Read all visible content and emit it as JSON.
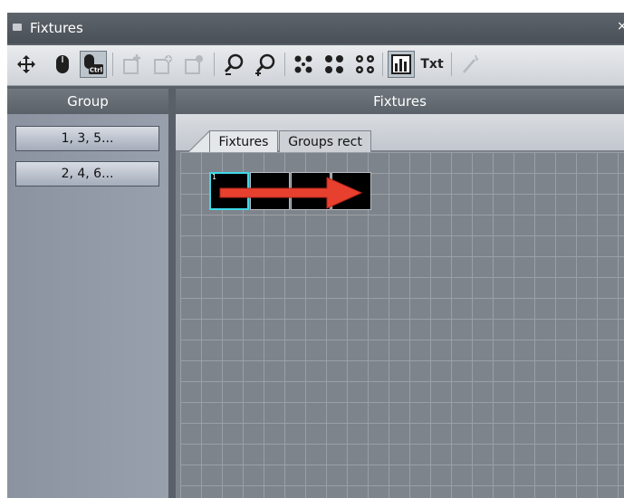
{
  "window": {
    "title": "Fixtures",
    "close_glyph": "×"
  },
  "toolbar": {
    "buttons": [
      {
        "name": "move-icon",
        "active": false,
        "enabled": true
      },
      {
        "name": "mouse-icon",
        "active": false,
        "enabled": true
      },
      {
        "name": "mouse-ctrl-icon",
        "active": true,
        "enabled": true,
        "label": "Ctrl"
      },
      {
        "name": "add-fixture-icon",
        "active": false,
        "enabled": false
      },
      {
        "name": "add-fixtures-icon",
        "active": false,
        "enabled": false
      },
      {
        "name": "fixture-settings-icon",
        "active": false,
        "enabled": false
      },
      {
        "name": "zoom-out-icon",
        "active": false,
        "enabled": true
      },
      {
        "name": "zoom-in-icon",
        "active": false,
        "enabled": true
      },
      {
        "name": "dots-large-icon",
        "active": false,
        "enabled": true
      },
      {
        "name": "dots-medium-icon",
        "active": false,
        "enabled": true
      },
      {
        "name": "dots-small-icon",
        "active": false,
        "enabled": true
      },
      {
        "name": "levels-icon",
        "active": true,
        "enabled": true
      },
      {
        "name": "text-toggle-icon",
        "active": false,
        "enabled": true,
        "label": "Txt"
      },
      {
        "name": "magic-wand-icon",
        "active": false,
        "enabled": false
      }
    ]
  },
  "left_panel": {
    "header": "Group",
    "groups": [
      "1, 3, 5...",
      "2, 4, 6..."
    ]
  },
  "right_panel": {
    "header": "Fixtures",
    "tabs": [
      {
        "label": "Fixtures",
        "selected": true
      },
      {
        "label": "Groups rect",
        "selected": false
      }
    ],
    "fixtures": [
      {
        "number": "1",
        "selected": true
      },
      {
        "number": "",
        "selected": false
      },
      {
        "number": "",
        "selected": false
      },
      {
        "number": "",
        "selected": false
      }
    ],
    "annotation": {
      "type": "arrow",
      "direction": "right",
      "color": "#e8402f"
    }
  },
  "colors": {
    "panel_bg": "#7e848b",
    "grid_line": "#9aa0a6",
    "selection": "#3fd9e8",
    "arrow": "#e8402f",
    "button_text": "#111111"
  }
}
